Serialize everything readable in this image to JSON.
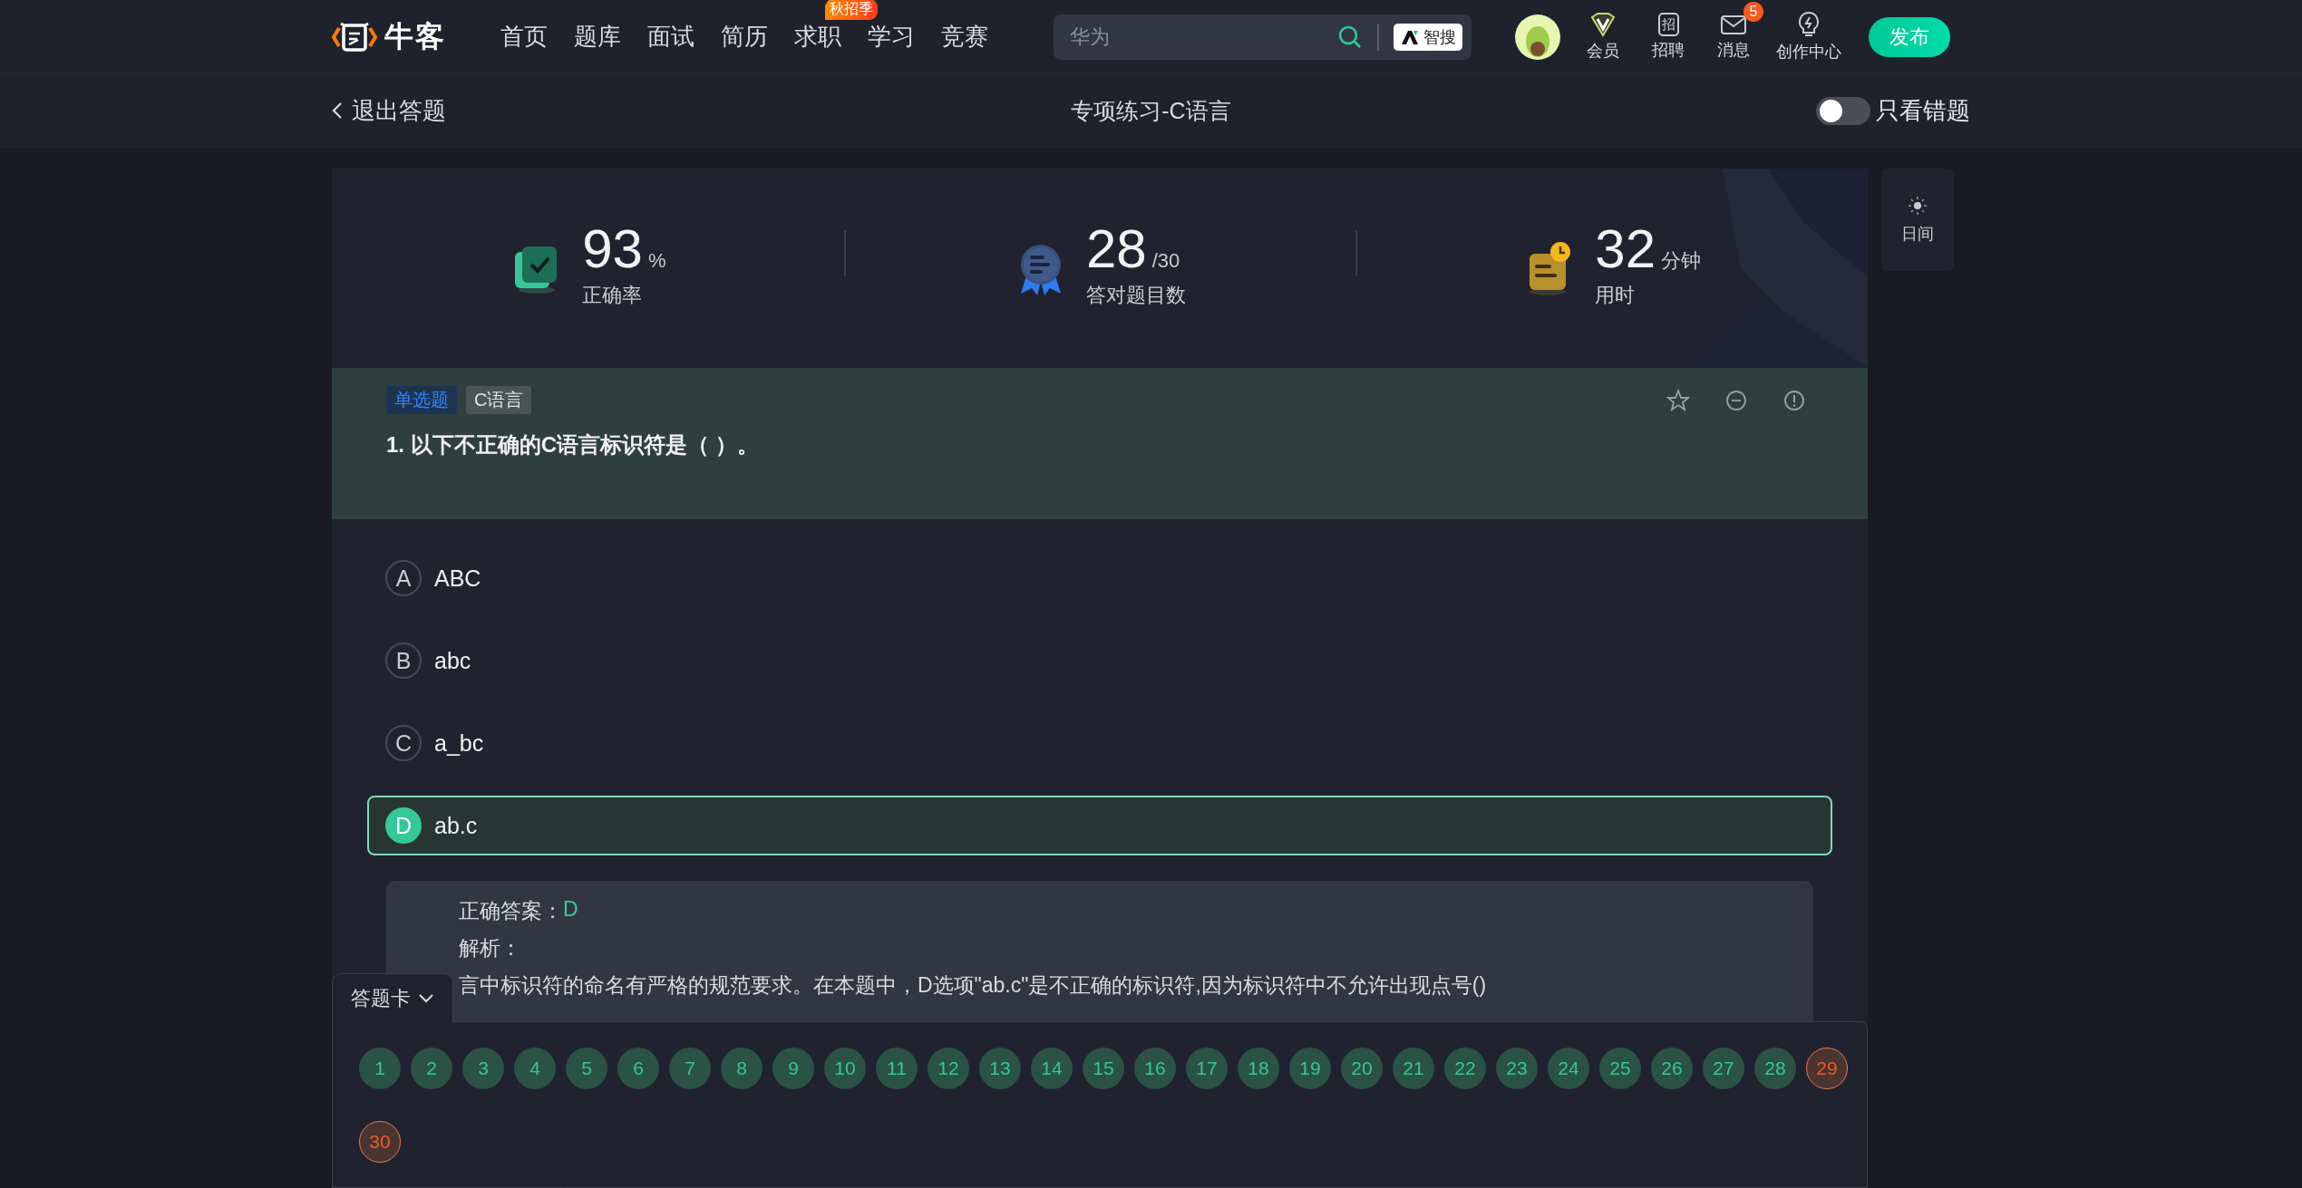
{
  "nav": {
    "logo": "牛客",
    "items": [
      {
        "label": "首页"
      },
      {
        "label": "题库"
      },
      {
        "label": "面试"
      },
      {
        "label": "简历"
      },
      {
        "label": "求职",
        "badge": "秋招季"
      },
      {
        "label": "学习"
      },
      {
        "label": "竞赛"
      }
    ],
    "search": {
      "placeholder": "华为"
    },
    "ai_search": "智搜",
    "shortcuts": [
      {
        "kind": "vip",
        "label": "会员"
      },
      {
        "kind": "recruit",
        "label": "招聘",
        "icon_text": "招"
      },
      {
        "kind": "message",
        "label": "消息",
        "badge": "5"
      },
      {
        "kind": "create",
        "label": "创作中心"
      }
    ],
    "publish": "发布"
  },
  "subbar": {
    "back": "退出答题",
    "title": "专项练习-C语言",
    "toggle": {
      "label": "只看错题",
      "on": false
    }
  },
  "stats": [
    {
      "kind": "accuracy",
      "value": "93",
      "unit": "%",
      "label": "正确率"
    },
    {
      "kind": "count",
      "value": "28",
      "unit": "/30",
      "label": "答对题目数"
    },
    {
      "kind": "time",
      "value": "32",
      "unit": "分钟",
      "label": "用时"
    }
  ],
  "question": {
    "tags": [
      {
        "kind": "type",
        "label": "单选题"
      },
      {
        "kind": "topic",
        "label": "C语言"
      }
    ],
    "text": "1. 以下不正确的C语言标识符是（ ）。"
  },
  "options": [
    {
      "letter": "A",
      "text": "ABC",
      "selected": false
    },
    {
      "letter": "B",
      "text": "abc",
      "selected": false
    },
    {
      "letter": "C",
      "text": "a_bc",
      "selected": false
    },
    {
      "letter": "D",
      "text": "ab.c",
      "selected": true
    }
  ],
  "answer": {
    "label": "正确答案：",
    "value": "D",
    "explanation_label": "解析：",
    "explanation": "言中标识符的命名有严格的规范要求。在本题中，D选项\"ab.c\"是不正确的标识符,因为标识符中不允许出现点号()"
  },
  "answer_card": {
    "title": "答题卡",
    "numbers": [
      {
        "label": "1",
        "correct": true
      },
      {
        "label": "2",
        "correct": true
      },
      {
        "label": "3",
        "correct": true
      },
      {
        "label": "4",
        "correct": true
      },
      {
        "label": "5",
        "correct": true
      },
      {
        "label": "6",
        "correct": true
      },
      {
        "label": "7",
        "correct": true
      },
      {
        "label": "8",
        "correct": true
      },
      {
        "label": "9",
        "correct": true
      },
      {
        "label": "10",
        "correct": true
      },
      {
        "label": "11",
        "correct": true
      },
      {
        "label": "12",
        "correct": true
      },
      {
        "label": "13",
        "correct": true
      },
      {
        "label": "14",
        "correct": true
      },
      {
        "label": "15",
        "correct": true
      },
      {
        "label": "16",
        "correct": true
      },
      {
        "label": "17",
        "correct": true
      },
      {
        "label": "18",
        "correct": true
      },
      {
        "label": "19",
        "correct": true
      },
      {
        "label": "20",
        "correct": true
      },
      {
        "label": "21",
        "correct": true
      },
      {
        "label": "22",
        "correct": true
      },
      {
        "label": "23",
        "correct": true
      },
      {
        "label": "24",
        "correct": true
      },
      {
        "label": "25",
        "correct": true
      },
      {
        "label": "26",
        "correct": true
      },
      {
        "label": "27",
        "correct": true
      },
      {
        "label": "28",
        "correct": true
      },
      {
        "label": "29",
        "correct": false
      },
      {
        "label": "30",
        "correct": false
      }
    ]
  },
  "theme_button": "日间"
}
